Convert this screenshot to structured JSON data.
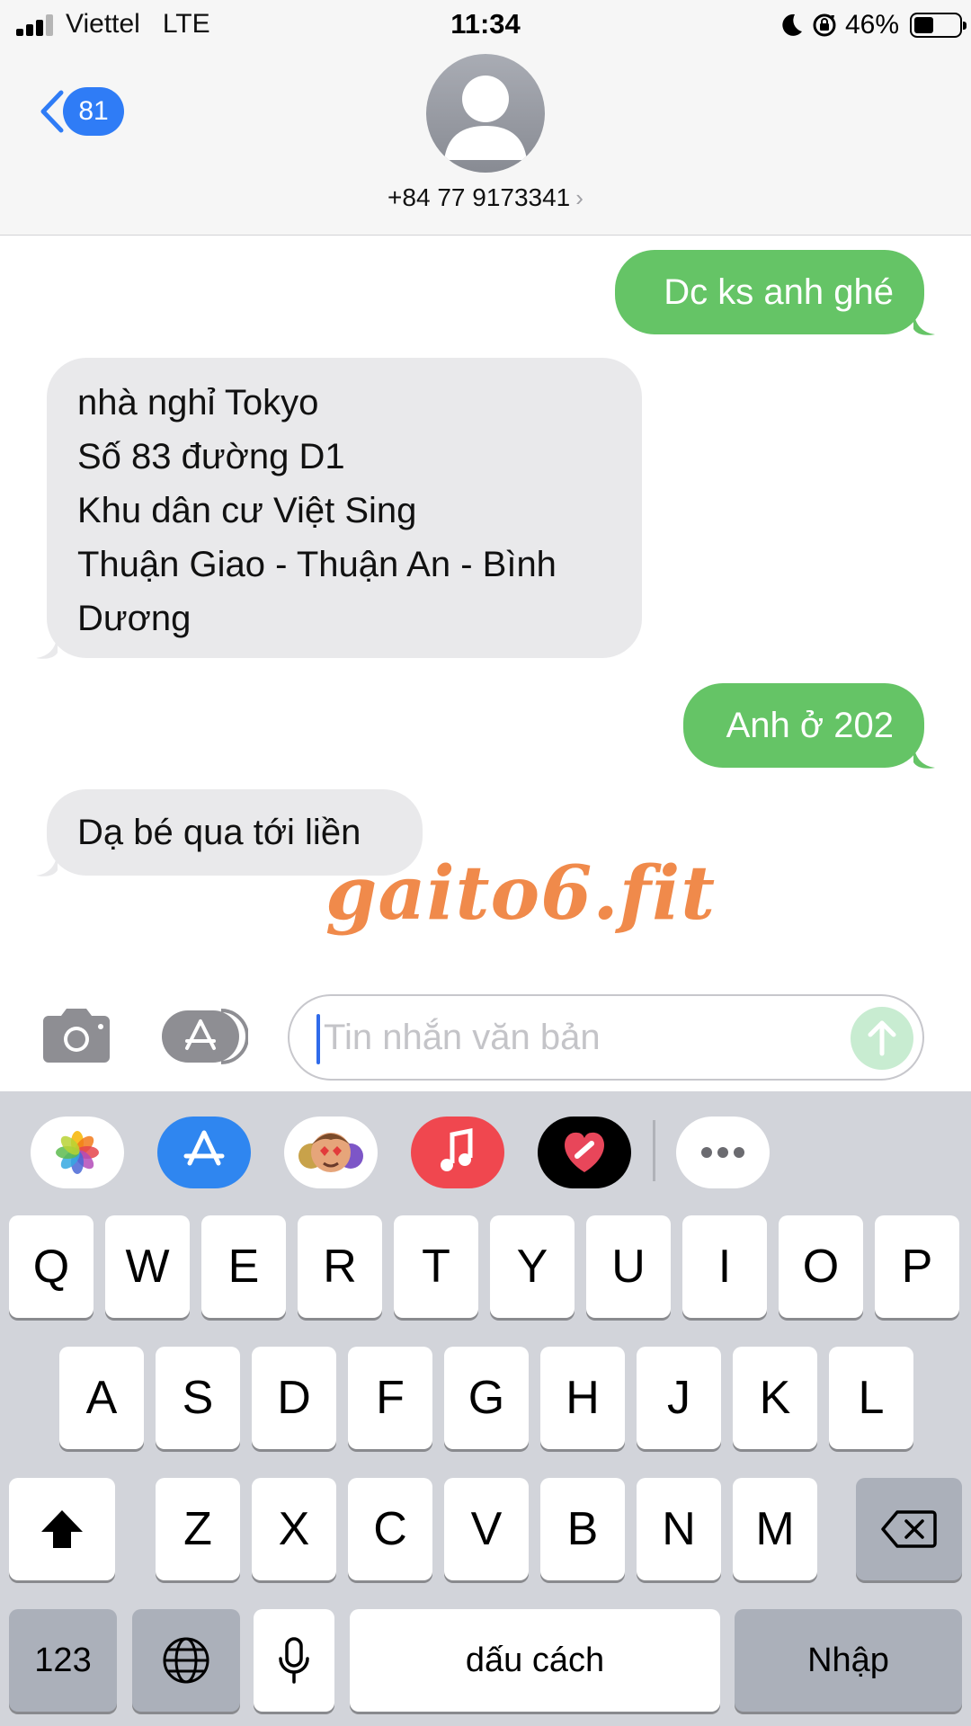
{
  "status_bar": {
    "carrier": "Viettel   LTE",
    "time": "11:34",
    "battery_percent": "46%",
    "battery_level": 0.46,
    "signal_bars": 3
  },
  "header": {
    "back_badge": "81",
    "contact": "+84 77 9173341",
    "chevron": "›"
  },
  "messages": [
    {
      "direction": "out",
      "lines": [
        "Dc ks anh ghé"
      ]
    },
    {
      "direction": "in",
      "lines": [
        "nhà nghỉ Tokyo",
        "Số 83 đường D1",
        "Khu dân cư Việt Sing",
        "Thuận Giao - Thuận An - Bình",
        "Dương"
      ]
    },
    {
      "direction": "out",
      "lines": [
        "Anh ở 202"
      ]
    },
    {
      "direction": "in",
      "lines": [
        "Dạ bé qua tới liền"
      ]
    }
  ],
  "watermark": "gaito6.fit",
  "input": {
    "placeholder": "Tin nhắn văn bản",
    "camera_icon": "camera-icon",
    "apps_icon": "app-store-icon",
    "send_icon": "arrow-up-icon"
  },
  "app_drawer": [
    {
      "name": "photos",
      "icon": "photos-icon"
    },
    {
      "name": "app-store",
      "icon": "app-store-icon"
    },
    {
      "name": "memoji",
      "icon": "memoji-icon"
    },
    {
      "name": "music",
      "icon": "music-icon"
    },
    {
      "name": "digital-touch",
      "icon": "heart-icon"
    },
    {
      "name": "more",
      "icon": "more-icon"
    }
  ],
  "keyboard": {
    "row1": [
      "Q",
      "W",
      "E",
      "R",
      "T",
      "Y",
      "U",
      "I",
      "O",
      "P"
    ],
    "row2": [
      "A",
      "S",
      "D",
      "F",
      "G",
      "H",
      "J",
      "K",
      "L"
    ],
    "row3": [
      "Z",
      "X",
      "C",
      "V",
      "B",
      "N",
      "M"
    ],
    "numbers_key": "123",
    "space_key": "dấu cách",
    "return_key": "Nhập",
    "shift_icon": "shift-icon",
    "delete_icon": "backspace-icon",
    "globe_icon": "globe-icon",
    "mic_icon": "microphone-icon"
  },
  "colors": {
    "outgoing_bubble": "#65c466",
    "incoming_bubble": "#e9e9eb",
    "accent_blue": "#2f7cf6",
    "watermark": "#f08a4b"
  }
}
